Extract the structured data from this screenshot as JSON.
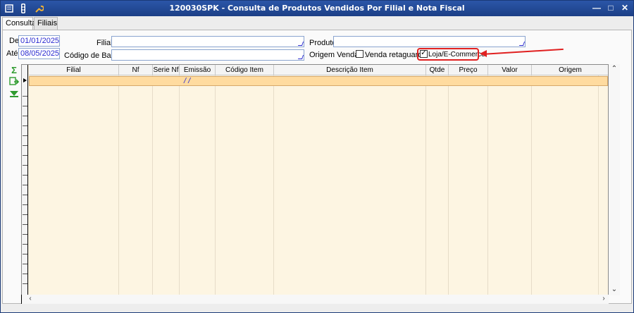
{
  "window": {
    "title": "120030SPK - Consulta de Produtos Vendidos Por Filial e Nota Fiscal",
    "icons": [
      "app-menu-icon",
      "traffic-light-icon",
      "wrench-icon"
    ],
    "controls": {
      "minimize": "—",
      "maximize": "□",
      "close": "✕"
    }
  },
  "tabs": [
    {
      "label": "Consulta",
      "active": true
    },
    {
      "label": "Filiais",
      "active": false
    }
  ],
  "form": {
    "de_label": "De",
    "de_value": "01/01/2025",
    "ate_label": "Até",
    "ate_value": "08/05/2025",
    "filial_label": "Filial",
    "filial_value": "",
    "codigo_barras_label": "Código de Barras",
    "codigo_barras_value": "",
    "produto_label": "Produto",
    "produto_value": "",
    "origem_label": "Origem Vendas :",
    "venda_retaguarda_label": "Venda retaguarda",
    "venda_retaguarda_checked": false,
    "loja_ecommerce_label": "Loja/E-Commerce",
    "loja_ecommerce_checked": true
  },
  "sidebar_icons": [
    "sum-icon",
    "export-icon",
    "filter-icon"
  ],
  "grid": {
    "columns": [
      "Filial",
      "Nf",
      "Serie Nf",
      "Emissão",
      "Código Item",
      "Descrição Item",
      "Qtde",
      "Preço",
      "Valor",
      "Origem"
    ],
    "rows": [
      {
        "emissao": "/ /"
      }
    ]
  },
  "colors": {
    "title_bar": "#1c3f86",
    "grid_background": "#fdf5e2",
    "selected_row": "#ffdb9f",
    "annotation": "#e02020",
    "field_text": "#2a2ad0"
  }
}
